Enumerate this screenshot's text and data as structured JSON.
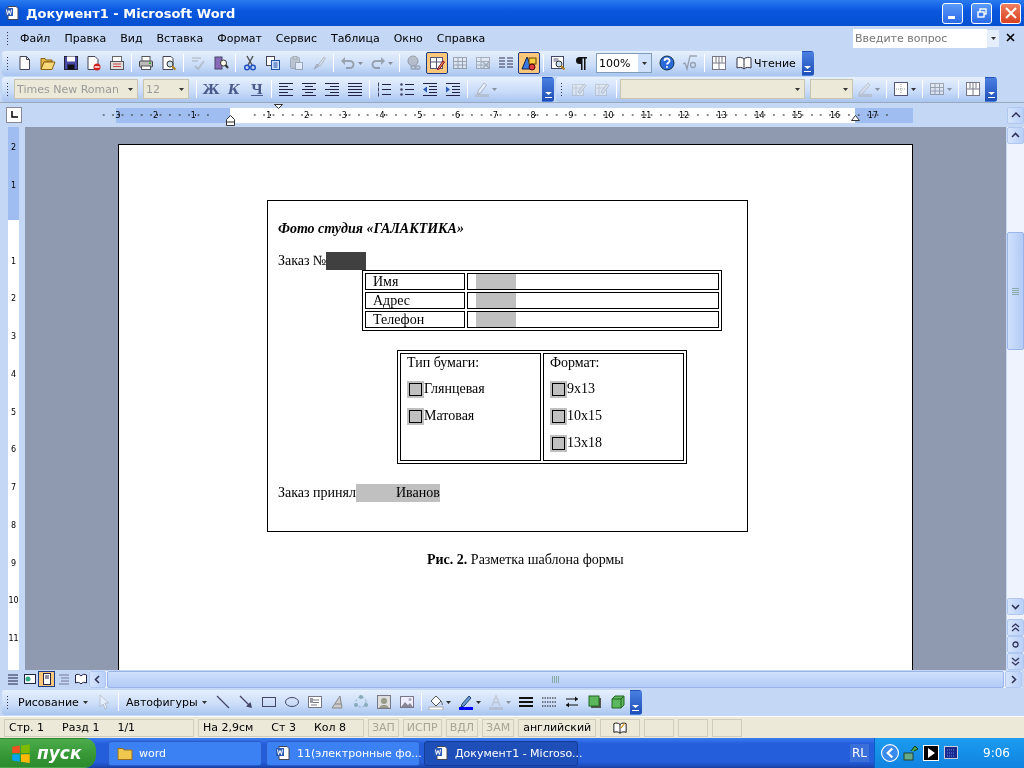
{
  "window": {
    "title": "Документ1 - Microsoft Word"
  },
  "menu": {
    "items": [
      "Файл",
      "Правка",
      "Вид",
      "Вставка",
      "Формат",
      "Сервис",
      "Таблица",
      "Окно",
      "Справка"
    ],
    "help": {
      "placeholder": "Введите вопрос"
    }
  },
  "standard_toolbar": {
    "buttons": [
      {
        "on": false,
        "disabled": false
      },
      {
        "on": false,
        "disabled": false
      },
      {
        "on": false,
        "disabled": false
      },
      {
        "on": false,
        "disabled": false
      },
      {
        "on": false,
        "disabled": false
      },
      {
        "on": false,
        "disabled": false
      },
      {
        "on": false,
        "disabled": false
      },
      {
        "on": false,
        "disabled": true
      },
      {
        "on": false,
        "disabled": false
      },
      {
        "on": false,
        "disabled": false
      },
      {
        "on": false,
        "disabled": false
      },
      {
        "on": false,
        "disabled": true
      },
      {
        "on": false,
        "disabled": true
      },
      {
        "on": false,
        "disabled": true
      },
      {
        "on": false,
        "disabled": true
      },
      {
        "on": false,
        "disabled": true
      },
      {
        "on": true,
        "disabled": false
      },
      {
        "on": false,
        "disabled": true
      },
      {
        "on": false,
        "disabled": true
      },
      {
        "on": false,
        "disabled": false
      },
      {
        "on": true,
        "disabled": false
      },
      {
        "on": false,
        "disabled": false
      },
      {
        "on": false,
        "disabled": false
      },
      {
        "on": false,
        "disabled": false
      },
      {
        "on": false,
        "disabled": true
      },
      {
        "on": false,
        "disabled": false
      }
    ],
    "zoom": "100%",
    "reading": "Чтение"
  },
  "formatting_toolbar": {
    "font": "Times New Roman",
    "size": "12",
    "disabled": true,
    "style_buttons": [
      "Ж",
      "К",
      "Ч"
    ]
  },
  "ruler": {
    "labels": [
      "3",
      "2",
      "1",
      "1",
      "2",
      "3",
      "4",
      "5",
      "6",
      "7",
      "8",
      "9",
      "10",
      "11",
      "12",
      "13",
      "14",
      "15",
      "16",
      "17"
    ]
  },
  "vertical_ruler": {
    "labels": [
      "2",
      "1",
      "1",
      "2",
      "3",
      "4",
      "5",
      "6",
      "7",
      "8",
      "9",
      "10",
      "11"
    ]
  },
  "document": {
    "heading": "Фото студия «ГАЛАКТИКА»",
    "order_label": "Заказ №",
    "client_rows": [
      {
        "label": "Имя"
      },
      {
        "label": "Адрес"
      },
      {
        "label": "Телефон"
      }
    ],
    "paper": {
      "title": "Тип бумаги:",
      "options": [
        {
          "label": "Глянцевая",
          "checked": false
        },
        {
          "label": "Матовая",
          "checked": false
        }
      ]
    },
    "format": {
      "title": "Формат:",
      "options": [
        {
          "label": "9x13",
          "checked": false
        },
        {
          "label": "10x15",
          "checked": false
        },
        {
          "label": "13x18",
          "checked": false
        }
      ]
    },
    "accepted_label": "Заказ принял",
    "accepted_value": "Иванов",
    "caption": "**Рис. 2.** Разметка шаблона формы"
  },
  "view_buttons": [
    {
      "selected": false
    },
    {
      "selected": false
    },
    {
      "selected": true
    },
    {
      "selected": false
    },
    {
      "selected": false
    }
  ],
  "drawing_toolbar": {
    "draw_menu": "Рисование",
    "autoshapes": "Автофигуры"
  },
  "status_bar": {
    "position": [
      "Стр. 1",
      "Разд 1",
      "1/1"
    ],
    "cursor": [
      "На 2,9см",
      "Ст 3",
      "Кол 8"
    ],
    "modes": [
      {
        "label": "ЗАП",
        "disabled": true
      },
      {
        "label": "ИСПР",
        "disabled": true
      },
      {
        "label": "ВДЛ",
        "disabled": true
      },
      {
        "label": "ЗАМ",
        "disabled": true
      }
    ],
    "language": "английский"
  },
  "taskbar": {
    "start": "пуск",
    "buttons": [
      {
        "label": "word",
        "kind": "folder",
        "selected": false
      },
      {
        "label": "11(электронные фо...",
        "kind": "document",
        "selected": false
      },
      {
        "label": "Документ1 - Microso...",
        "kind": "document",
        "selected": true
      }
    ],
    "tray": {
      "language": "RL",
      "clock": "9:06"
    }
  }
}
